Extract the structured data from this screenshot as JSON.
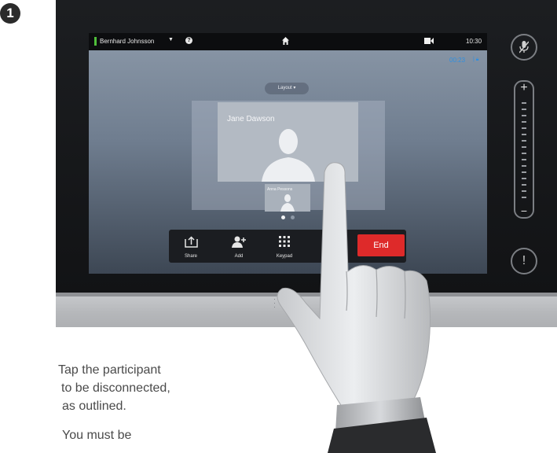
{
  "step_number": "1",
  "screen": {
    "status_bar": {
      "user_name": "Bernhard Johnsson",
      "clock": "10:30"
    },
    "call_timer": "00:23",
    "layout_button_label": "Layout",
    "main_participant": "Jane Dawson",
    "thumbnail_participant": "Anna Pessons",
    "pager": {
      "current": 1,
      "total": 2
    },
    "toolbar": {
      "share_label": "Share",
      "add_label": "Add",
      "keypad_label": "Keypad",
      "end_label": "End"
    }
  },
  "side_controls": {
    "volume_plus": "+",
    "volume_minus": "−",
    "alert_symbol": "!"
  },
  "instructions": [
    "Tap the participant",
    "to be disconnected,",
    "as outlined.",
    "You must be"
  ],
  "colors": {
    "end_button": "#de2a2a",
    "timer_blue": "#2f8fe0",
    "presence_green": "#4fbf3a"
  }
}
